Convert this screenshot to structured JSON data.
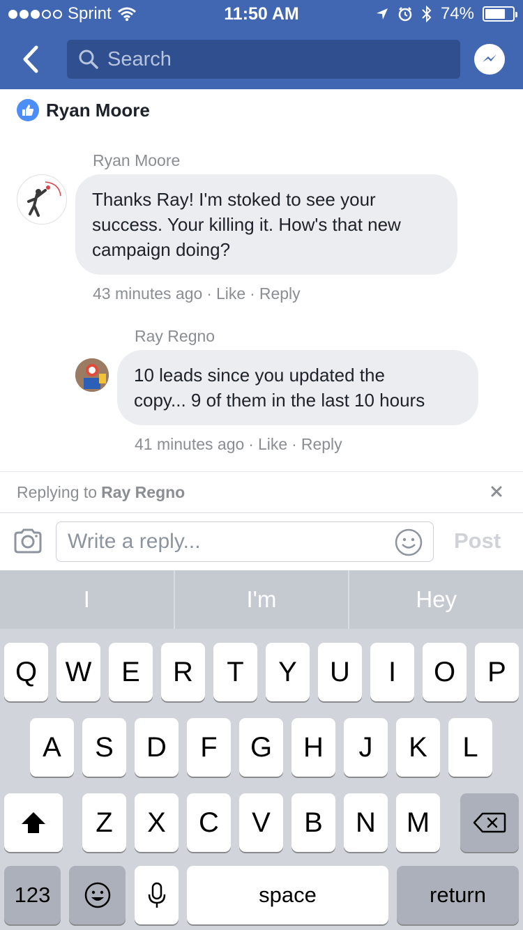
{
  "status_bar": {
    "carrier": "Sprint",
    "time": "11:50 AM",
    "battery": "74%",
    "battery_level": 0.74,
    "icons": [
      "wifi-icon",
      "location-arrow-icon",
      "alarm-icon",
      "bluetooth-icon",
      "battery-icon"
    ]
  },
  "nav": {
    "search_placeholder": "Search",
    "icons": [
      "back-arrow-icon",
      "search-icon",
      "messenger-icon"
    ]
  },
  "colors": {
    "brand_blue": "#4267b2",
    "search_bg": "#2f4f8f",
    "bubble_bg": "#ebedf0",
    "like_blue": "#4b8ef7"
  },
  "liker": {
    "name": "Ryan Moore"
  },
  "comments": [
    {
      "author": "Ryan Moore",
      "text_lines": [
        "Thanks Ray! I'm stoked to see your",
        "success. Your killing it. How's that new",
        "campaign doing?"
      ],
      "time": "43 minutes ago",
      "sep": "·",
      "like": "Like",
      "reply": "Reply"
    },
    {
      "author": "Ray Regno",
      "text_lines": [
        "10 leads since you updated the",
        "copy... 9 of them in the last 10 hours"
      ],
      "time": "41 minutes ago",
      "sep": "·",
      "like": "Like",
      "reply": "Reply"
    }
  ],
  "reply_bar": {
    "prefix": "Replying to",
    "name": "Ray Regno"
  },
  "composer": {
    "placeholder": "Write a reply...",
    "post_label": "Post"
  },
  "keyboard": {
    "predictions": [
      "I",
      "I'm",
      "Hey"
    ],
    "row1": [
      "Q",
      "W",
      "E",
      "R",
      "T",
      "Y",
      "U",
      "I",
      "O",
      "P"
    ],
    "row2": [
      "A",
      "S",
      "D",
      "F",
      "G",
      "H",
      "J",
      "K",
      "L"
    ],
    "row3": [
      "Z",
      "X",
      "C",
      "V",
      "B",
      "N",
      "M"
    ],
    "numbers_label": "123",
    "space_label": "space",
    "return_label": "return"
  }
}
